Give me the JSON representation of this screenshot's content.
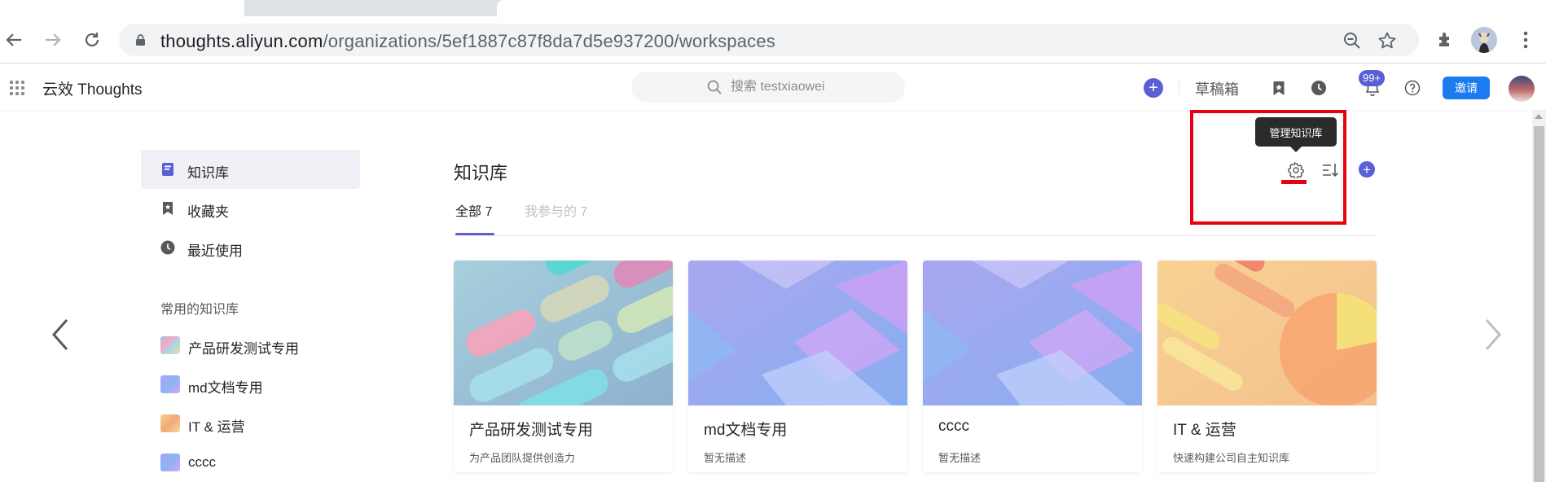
{
  "browser": {
    "url_host": "thoughts.aliyun.com",
    "url_path": "/organizations/5ef1887c87f8da7d5e937200/workspaces",
    "icons": [
      "back-icon",
      "forward-icon",
      "reload-icon",
      "lock-icon",
      "zoom-out-icon",
      "bookmark-star-icon",
      "extensions-icon",
      "profile-avatar",
      "more-vert-icon"
    ]
  },
  "header": {
    "app_name": "云效 Thoughts",
    "search_placeholder": "搜索 testxiaowei",
    "drafts_label": "草稿箱",
    "notification_badge": "99+",
    "invite_label": "邀请"
  },
  "sidebar": {
    "items": [
      {
        "label": "知识库",
        "icon": "book-icon",
        "active": true
      },
      {
        "label": "收藏夹",
        "icon": "bookmark-icon",
        "active": false
      },
      {
        "label": "最近使用",
        "icon": "clock-icon",
        "active": false
      }
    ],
    "favorites_heading": "常用的知识库",
    "favorites": [
      {
        "label": "产品研发测试专用"
      },
      {
        "label": "md文档专用"
      },
      {
        "label": "IT & 运营"
      },
      {
        "label": "cccc"
      }
    ]
  },
  "main": {
    "title": "知识库",
    "tabs": [
      {
        "label": "全部 7",
        "active": true
      },
      {
        "label": "我参与的 7",
        "active": false
      }
    ],
    "tooltip": "管理知识库",
    "cards": [
      {
        "title": "产品研发测试专用",
        "description": "为产品团队提供创造力"
      },
      {
        "title": "md文档专用",
        "description": "暂无描述"
      },
      {
        "title": "cccc",
        "description": "暂无描述"
      },
      {
        "title": "IT & 运营",
        "description": "快速构建公司自主知识库"
      }
    ]
  },
  "colors": {
    "accent": "#5a5fd6",
    "invite_button": "#1b7cf0",
    "highlight": "#e60012"
  }
}
